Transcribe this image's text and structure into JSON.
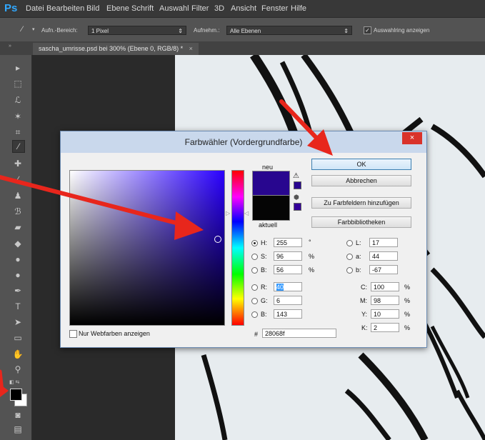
{
  "app": {
    "logo": "Ps",
    "menu": [
      "Datei",
      "Bearbeiten",
      "Bild",
      "Ebene",
      "Schrift",
      "Auswahl",
      "Filter",
      "3D",
      "Ansicht",
      "Fenster",
      "Hilfe"
    ]
  },
  "options": {
    "aufn_label": "Aufn.-Bereich:",
    "aufn_value": "1 Pixel",
    "aufnehm_label": "Aufnehm.:",
    "aufnehm_value": "Alle Ebenen",
    "ring_label": "Auswahlring anzeigen",
    "ring_checked": true
  },
  "document": {
    "tab_title": "sascha_umrisse.psd bei 300% (Ebene 0, RGB/8) *",
    "close": "×"
  },
  "dialog": {
    "title": "Farbwähler (Vordergrundfarbe)",
    "close": "×",
    "neu": "neu",
    "aktuell": "aktuell",
    "new_color": "#28068f",
    "current_color": "#050505",
    "buttons": {
      "ok": "OK",
      "cancel": "Abbrechen",
      "add_swatches": "Zu Farbfeldern hinzufügen",
      "libraries": "Farbbibliotheken"
    },
    "web_only_label": "Nur Webfarben anzeigen",
    "hsb": {
      "H": "255",
      "S": "96",
      "B": "56",
      "h_unit": "°",
      "s_unit": "%",
      "b_unit": "%"
    },
    "rgb": {
      "R": "40",
      "G": "6",
      "B": "143"
    },
    "lab": {
      "L": "17",
      "a": "44",
      "b": "-67"
    },
    "cmyk": {
      "C": "100",
      "M": "98",
      "Y": "10",
      "K": "2",
      "unit": "%"
    },
    "hex_label": "#",
    "hex": "28068f",
    "labels": {
      "H": "H:",
      "S": "S:",
      "B": "B:",
      "R": "R:",
      "G": "G:",
      "B2": "B:",
      "L": "L:",
      "a": "a:",
      "b": "b:",
      "C": "C:",
      "M": "M:",
      "Y": "Y:",
      "K": "K:"
    }
  },
  "colors": {
    "accent_red_arrow": "#e8261c",
    "foreground": "#000000",
    "background": "#ffffff"
  }
}
